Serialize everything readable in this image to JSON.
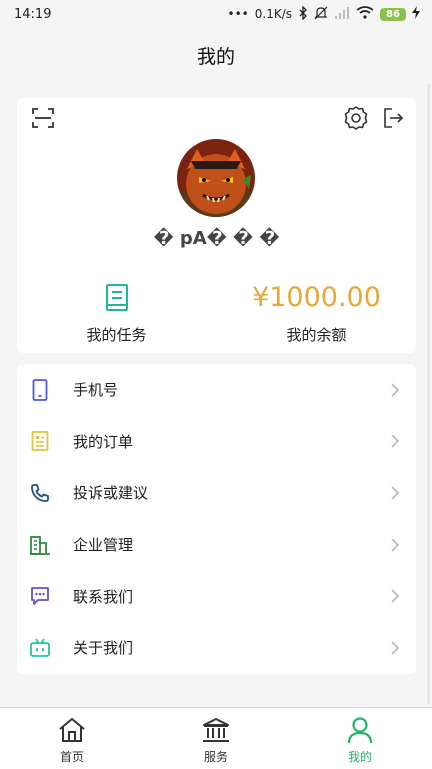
{
  "status_bar": {
    "time": "14:19",
    "network_speed": "0.1K/s",
    "battery": "86"
  },
  "header": {
    "title": "我的"
  },
  "profile": {
    "username": "� pA� � �",
    "task_label": "我的任务",
    "balance_value": "¥1000.00",
    "balance_label": "我的余额"
  },
  "menu": {
    "items": [
      {
        "label": "手机号",
        "icon": "phone-icon",
        "color": "#5557d6"
      },
      {
        "label": "我的订单",
        "icon": "order-list-icon",
        "color": "#e6c23a"
      },
      {
        "label": "投诉或建议",
        "icon": "call-icon",
        "color": "#1f4f8a"
      },
      {
        "label": "企业管理",
        "icon": "building-icon",
        "color": "#2e8b3e"
      },
      {
        "label": "联系我们",
        "icon": "chat-icon",
        "color": "#6a4fc6"
      },
      {
        "label": "关于我们",
        "icon": "tv-icon",
        "color": "#26c2a0"
      }
    ]
  },
  "bottom_nav": {
    "home_label": "首页",
    "services_label": "服务",
    "mine_label": "我的"
  },
  "colors": {
    "accent": "#26b36a",
    "balance": "#e8a838",
    "task_icon": "#20b89a"
  }
}
